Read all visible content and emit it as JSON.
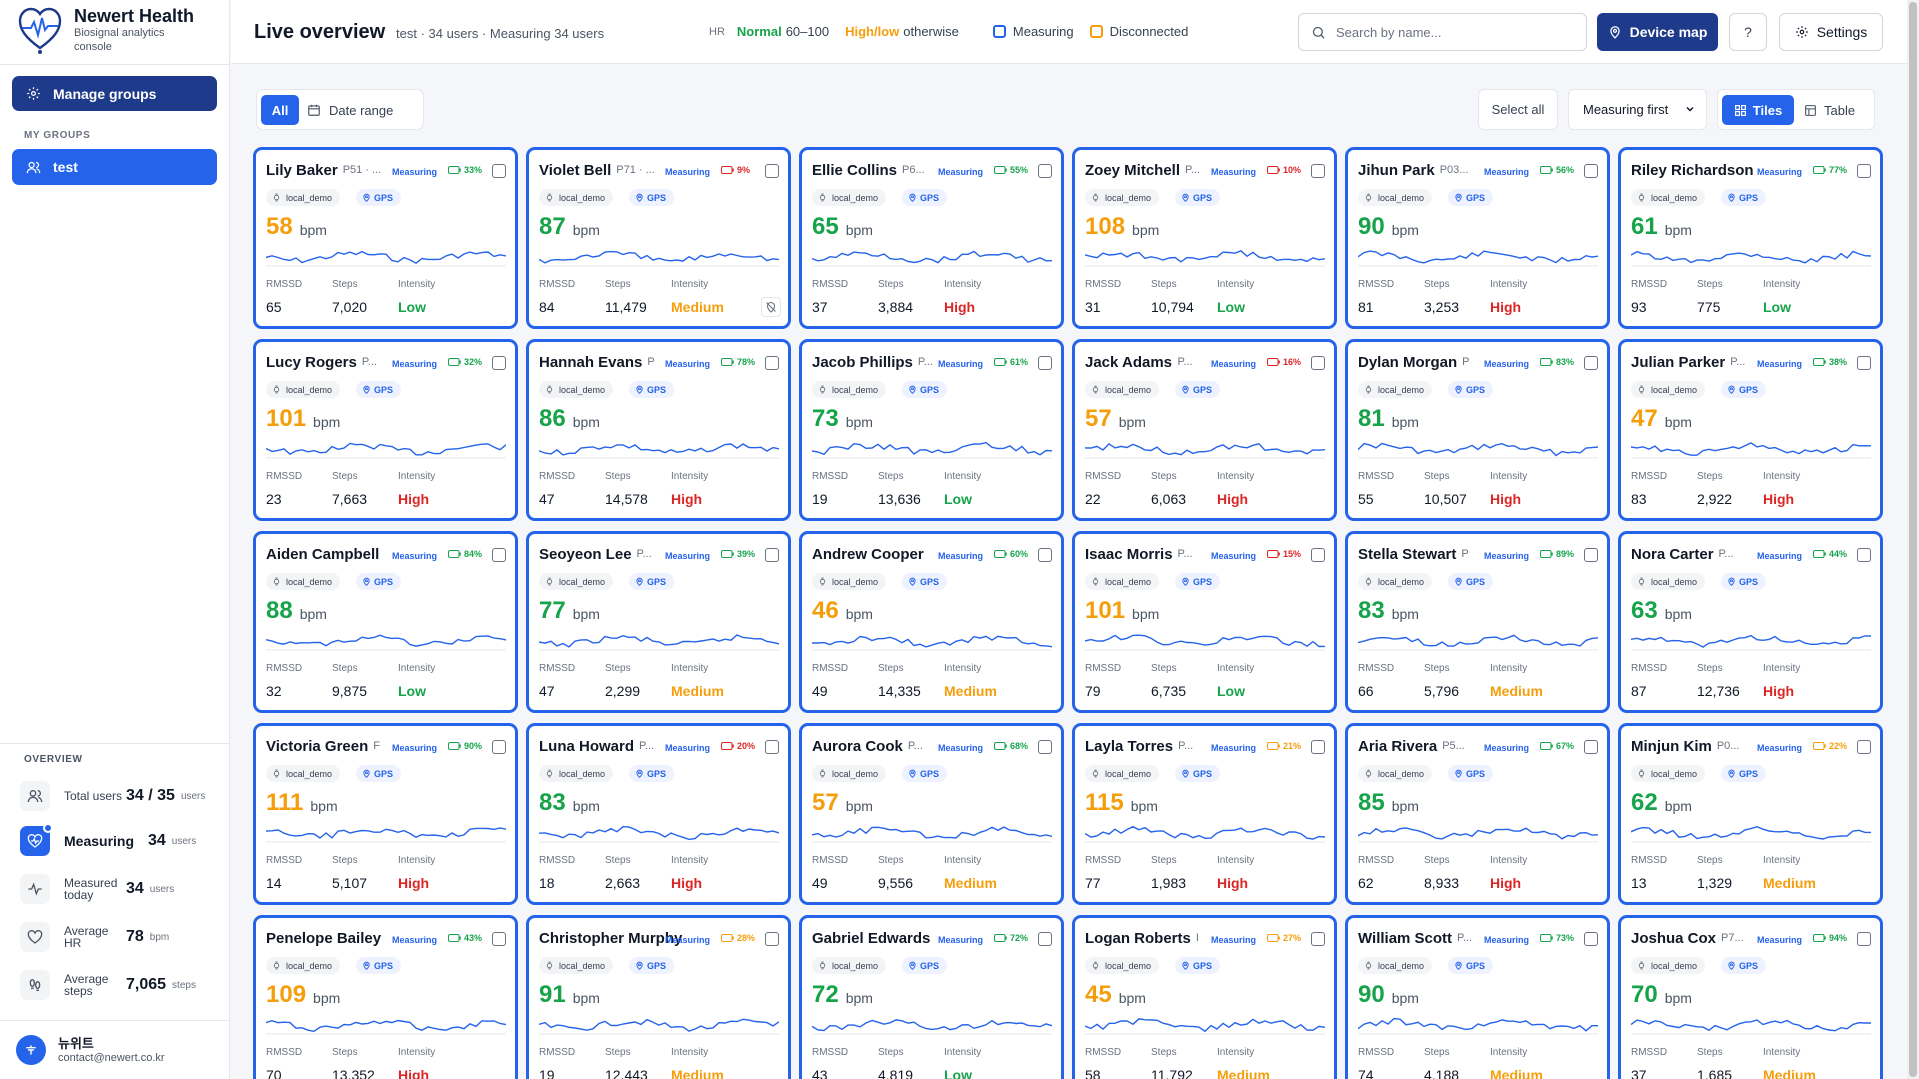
{
  "app": {
    "name": "Newert Health",
    "subtitle": "Biosignal analytics console"
  },
  "sidebar": {
    "manage_groups": "Manage groups",
    "my_groups_label": "MY GROUPS",
    "groups": [
      {
        "label": "test"
      }
    ],
    "overview_label": "OVERVIEW",
    "overview": [
      {
        "label": "Total users",
        "value": "34 / 35",
        "unit": "users",
        "icon": "users-icon"
      },
      {
        "label": "Measuring",
        "value": "34",
        "unit": "users",
        "icon": "heart-pulse-icon"
      },
      {
        "label": "Measured today",
        "value": "34",
        "unit": "users",
        "icon": "activity-icon"
      },
      {
        "label": "Average HR",
        "value": "78",
        "unit": "bpm",
        "icon": "heart-icon"
      },
      {
        "label": "Average steps",
        "value": "7,065",
        "unit": "steps",
        "icon": "footprints-icon"
      }
    ],
    "user": {
      "name": "뉴위트",
      "email": "contact@newert.co.kr"
    }
  },
  "header": {
    "title": "Live overview",
    "subtitle": "test · 34 users · Measuring 34 users",
    "legend": {
      "hr": "HR",
      "normal": "Normal",
      "normal_range": "60–100",
      "highlow": "High/low",
      "otherwise": "otherwise",
      "measuring": "Measuring",
      "disconnected": "Disconnected"
    },
    "search_placeholder": "Search by name...",
    "device_map": "Device map",
    "help": "?",
    "settings": "Settings"
  },
  "toolbar": {
    "all": "All",
    "date_range": "Date range",
    "select_all": "Select all",
    "sort": "Measuring first",
    "tiles": "Tiles",
    "table": "Table"
  },
  "colors": {
    "accent": "#2563eb",
    "navy": "#1e3a8a",
    "normal": "#16a34a",
    "warn": "#f59e0b",
    "high": "#dc2626"
  },
  "card_labels": {
    "measuring": "Measuring",
    "source": "local_demo",
    "gps": "GPS",
    "bpm": "bpm",
    "rmssd": "RMSSD",
    "steps": "Steps",
    "intensity": "Intensity"
  },
  "cards": [
    {
      "name": "Lily Baker",
      "id": "P51 · ...",
      "battery": "33%",
      "bpm": "58",
      "rmssd": "65",
      "steps": "7,020",
      "intensity": "Low"
    },
    {
      "name": "Violet Bell",
      "id": "P71 · ...",
      "battery": "9%",
      "bpm": "87",
      "rmssd": "84",
      "steps": "11,479",
      "intensity": "Medium",
      "no_location": true
    },
    {
      "name": "Ellie Collins",
      "id": "P6...",
      "battery": "55%",
      "bpm": "65",
      "rmssd": "37",
      "steps": "3,884",
      "intensity": "High"
    },
    {
      "name": "Zoey Mitchell",
      "id": "P...",
      "battery": "10%",
      "bpm": "108",
      "rmssd": "31",
      "steps": "10,794",
      "intensity": "Low"
    },
    {
      "name": "Jihun Park",
      "id": "P03...",
      "battery": "56%",
      "bpm": "90",
      "rmssd": "81",
      "steps": "3,253",
      "intensity": "High"
    },
    {
      "name": "Riley Richardson",
      "id": "",
      "battery": "77%",
      "bpm": "61",
      "rmssd": "93",
      "steps": "775",
      "intensity": "Low"
    },
    {
      "name": "Lucy Rogers",
      "id": "P...",
      "battery": "32%",
      "bpm": "101",
      "rmssd": "23",
      "steps": "7,663",
      "intensity": "High"
    },
    {
      "name": "Hannah Evans",
      "id": "P",
      "battery": "78%",
      "bpm": "86",
      "rmssd": "47",
      "steps": "14,578",
      "intensity": "High"
    },
    {
      "name": "Jacob Phillips",
      "id": "P...",
      "battery": "61%",
      "bpm": "73",
      "rmssd": "19",
      "steps": "13,636",
      "intensity": "Low"
    },
    {
      "name": "Jack Adams",
      "id": "P...",
      "battery": "16%",
      "bpm": "57",
      "rmssd": "22",
      "steps": "6,063",
      "intensity": "High"
    },
    {
      "name": "Dylan Morgan",
      "id": "P",
      "battery": "83%",
      "bpm": "81",
      "rmssd": "55",
      "steps": "10,507",
      "intensity": "High"
    },
    {
      "name": "Julian Parker",
      "id": "P...",
      "battery": "38%",
      "bpm": "47",
      "rmssd": "83",
      "steps": "2,922",
      "intensity": "High"
    },
    {
      "name": "Aiden Campbell",
      "id": "",
      "battery": "84%",
      "bpm": "88",
      "rmssd": "32",
      "steps": "9,875",
      "intensity": "Low"
    },
    {
      "name": "Seoyeon Lee",
      "id": "P...",
      "battery": "39%",
      "bpm": "77",
      "rmssd": "47",
      "steps": "2,299",
      "intensity": "Medium"
    },
    {
      "name": "Andrew Cooper",
      "id": "",
      "battery": "60%",
      "bpm": "46",
      "rmssd": "49",
      "steps": "14,335",
      "intensity": "Medium"
    },
    {
      "name": "Isaac Morris",
      "id": "P...",
      "battery": "15%",
      "bpm": "101",
      "rmssd": "79",
      "steps": "6,735",
      "intensity": "Low"
    },
    {
      "name": "Stella Stewart",
      "id": "P",
      "battery": "89%",
      "bpm": "83",
      "rmssd": "66",
      "steps": "5,796",
      "intensity": "Medium"
    },
    {
      "name": "Nora Carter",
      "id": "P...",
      "battery": "44%",
      "bpm": "63",
      "rmssd": "87",
      "steps": "12,736",
      "intensity": "High"
    },
    {
      "name": "Victoria Green",
      "id": "F",
      "battery": "90%",
      "bpm": "111",
      "rmssd": "14",
      "steps": "5,107",
      "intensity": "High"
    },
    {
      "name": "Luna Howard",
      "id": "P...",
      "battery": "20%",
      "bpm": "83",
      "rmssd": "18",
      "steps": "2,663",
      "intensity": "High"
    },
    {
      "name": "Aurora Cook",
      "id": "P...",
      "battery": "68%",
      "bpm": "57",
      "rmssd": "49",
      "steps": "9,556",
      "intensity": "Medium"
    },
    {
      "name": "Layla Torres",
      "id": "P...",
      "battery": "21%",
      "bpm": "115",
      "rmssd": "77",
      "steps": "1,983",
      "intensity": "High"
    },
    {
      "name": "Aria Rivera",
      "id": "P5...",
      "battery": "67%",
      "bpm": "85",
      "rmssd": "62",
      "steps": "8,933",
      "intensity": "High"
    },
    {
      "name": "Minjun Kim",
      "id": "P0...",
      "battery": "22%",
      "bpm": "62",
      "rmssd": "13",
      "steps": "1,329",
      "intensity": "Medium"
    },
    {
      "name": "Penelope Bailey",
      "id": "",
      "battery": "43%",
      "bpm": "109",
      "rmssd": "70",
      "steps": "13,352",
      "intensity": "High"
    },
    {
      "name": "Christopher Murphy",
      "id": "",
      "battery": "28%",
      "bpm": "91",
      "rmssd": "19",
      "steps": "12,443",
      "intensity": "Medium"
    },
    {
      "name": "Gabriel Edwards",
      "id": "",
      "battery": "72%",
      "bpm": "72",
      "rmssd": "43",
      "steps": "4,819",
      "intensity": "Low"
    },
    {
      "name": "Logan Roberts",
      "id": "I",
      "battery": "27%",
      "bpm": "45",
      "rmssd": "58",
      "steps": "11,792",
      "intensity": "Medium"
    },
    {
      "name": "William Scott",
      "id": "P...",
      "battery": "73%",
      "bpm": "90",
      "rmssd": "74",
      "steps": "4,188",
      "intensity": "Medium"
    },
    {
      "name": "Joshua Cox",
      "id": "P7...",
      "battery": "94%",
      "bpm": "70",
      "rmssd": "37",
      "steps": "1,685",
      "intensity": "Medium"
    }
  ]
}
